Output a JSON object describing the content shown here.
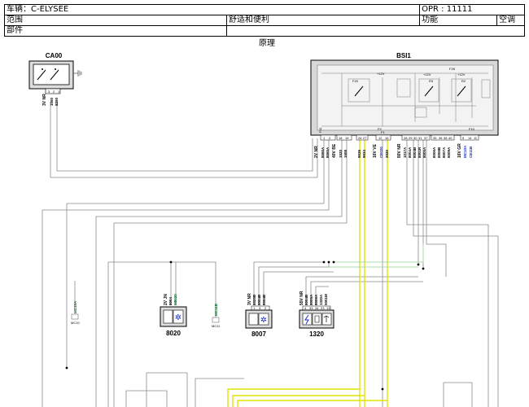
{
  "header": {
    "vehicle": "车辆：C-ELYSEE",
    "opr": "OPR : 11111",
    "scope_label": "范围",
    "scope_value": "舒适和便利",
    "function_label": "功能",
    "function_value": "空调",
    "part_label": "部件",
    "part_value": ""
  },
  "diagram": {
    "title": "原理",
    "colors": {
      "yellow": "#e6e600",
      "green": "#8fd08f",
      "blue": "#1a2dcc",
      "darkgreen": "#0a6a2a",
      "wire": "#888888"
    },
    "components": {
      "ca00": {
        "name": "CA00",
        "harness": "3V NR",
        "pins": [
          "3",
          "2",
          "1"
        ],
        "codes": [
          "1050",
          "8250"
        ]
      },
      "bsi1": {
        "name": "BSI1",
        "plus12v": "+12V",
        "f28": "F28",
        "f20": "F20",
        "r3": "R3",
        "r2": "R2",
        "f11": "F11",
        "f2": "F2",
        "f1": "F1",
        "f10": "F10",
        "connectors": [
          {
            "harness": "2V NR",
            "codes": [
              "8060A",
              "8060A"
            ],
            "pins": [
              "1",
              "2"
            ]
          },
          {
            "harness": "40V BE",
            "codes": [
              "1020",
              "1608"
            ],
            "pins": [
              "18",
              "19"
            ]
          },
          {
            "harness": "",
            "codes": [
              "9035",
              "9034"
            ],
            "pins": [
              "26",
              "27"
            ]
          },
          {
            "harness": "16V VE",
            "codes": [
              "CE020",
              "2020"
            ],
            "pins": [
              "12",
              "16"
            ]
          },
          {
            "harness": "80V NR",
            "codes": [
              "1017A",
              "8004A",
              "8004B",
              "8001R",
              "8005A"
            ],
            "pins": [
              "28",
              "29",
              "30",
              "31",
              "37"
            ]
          },
          {
            "harness": "",
            "codes": [
              "8006A",
              "8006B",
              "8007A",
              "8009A"
            ],
            "pins": [
              "35",
              "36",
              "38",
              "40"
            ]
          },
          {
            "harness": "16V GR",
            "codes": [
              "MC10A",
              "CE11B"
            ],
            "pins": [
              "5",
              "14",
              "11"
            ]
          }
        ]
      },
      "mc10": {
        "name": "MC10A",
        "label": "MC10"
      },
      "mc11": {
        "name": "MC11B",
        "label": "MC11"
      },
      "c8020": {
        "name": "8020",
        "harness": "2V JN",
        "codes": [
          "8004",
          "M8020"
        ]
      },
      "c8007": {
        "name": "8007",
        "harness": "3V NR",
        "codes": [
          "8020B",
          "8004B",
          "8004B"
        ],
        "pins": [
          "1",
          "3",
          "2"
        ]
      },
      "c1320": {
        "name": "1320",
        "harness": "55V NR",
        "codes": [
          "8004B",
          "8005A",
          "8006A",
          "1320A",
          "5001M"
        ],
        "pins": [
          "4",
          "33",
          "34",
          "23",
          "13"
        ]
      }
    }
  }
}
